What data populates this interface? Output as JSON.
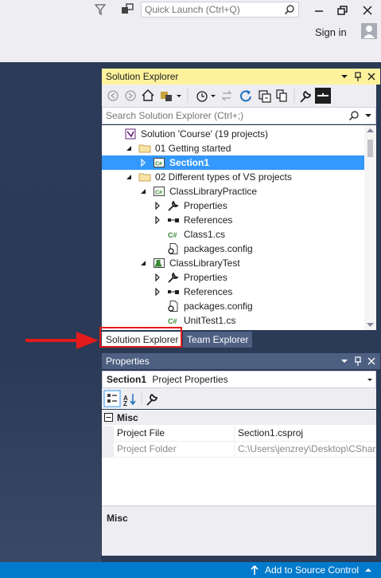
{
  "topbar": {
    "quick_launch_placeholder": "Quick Launch (Ctrl+Q)",
    "sign_in": "Sign in",
    "icons": [
      "filter-icon",
      "feedback-icon",
      "search-icon",
      "minimize-icon",
      "restore-icon",
      "close-icon",
      "account-icon"
    ]
  },
  "solution_explorer": {
    "title": "Solution Explorer",
    "search_placeholder": "Search Solution Explorer (Ctrl+;)",
    "toolbar_icons": [
      "back-icon",
      "forward-icon",
      "home-icon",
      "switch-views-icon",
      "pending-changes-icon",
      "sync-icon",
      "refresh-icon",
      "collapse-all-icon",
      "show-all-files-icon",
      "properties-icon",
      "preview-icon"
    ],
    "tree": [
      {
        "label": "Solution 'Course' (19 projects)",
        "icon": "solution-icon",
        "expander": "none",
        "selected": false
      },
      {
        "label": "01 Getting started",
        "icon": "folder-icon",
        "expander": "expanded",
        "selected": false
      },
      {
        "label": "Section1",
        "icon": "csharp-project-icon",
        "expander": "collapsed",
        "selected": true
      },
      {
        "label": "02 Different types of VS projects",
        "icon": "folder-icon",
        "expander": "expanded",
        "selected": false
      },
      {
        "label": "ClassLibraryPractice",
        "icon": "csharp-project-icon",
        "expander": "expanded",
        "selected": false
      },
      {
        "label": "Properties",
        "icon": "wrench-icon",
        "expander": "collapsed",
        "selected": false
      },
      {
        "label": "References",
        "icon": "references-icon",
        "expander": "collapsed",
        "selected": false
      },
      {
        "label": "Class1.cs",
        "icon": "csharp-file-icon",
        "expander": "none",
        "selected": false
      },
      {
        "label": "packages.config",
        "icon": "config-file-icon",
        "expander": "none",
        "selected": false
      },
      {
        "label": "ClassLibraryTest",
        "icon": "test-project-icon",
        "expander": "expanded",
        "selected": false
      },
      {
        "label": "Properties",
        "icon": "wrench-icon",
        "expander": "collapsed",
        "selected": false
      },
      {
        "label": "References",
        "icon": "references-icon",
        "expander": "collapsed",
        "selected": false
      },
      {
        "label": "packages.config",
        "icon": "config-file-icon",
        "expander": "none",
        "selected": false
      },
      {
        "label": "UnitTest1.cs",
        "icon": "csharp-file-icon",
        "expander": "none",
        "selected": false
      }
    ]
  },
  "tabs": [
    {
      "label": "Solution Explorer",
      "active": true
    },
    {
      "label": "Team Explorer",
      "active": false
    }
  ],
  "properties": {
    "title": "Properties",
    "object_name": "Section1",
    "object_type": "Project Properties",
    "category": "Misc",
    "rows": [
      {
        "name": "Project File",
        "value": "Section1.csproj",
        "readonly": false
      },
      {
        "name": "Project Folder",
        "value": "C:\\Users\\jenzrey\\Desktop\\CSharp",
        "readonly": true
      }
    ],
    "description_title": "Misc"
  },
  "status_bar": {
    "source_control": "Add to Source Control"
  },
  "colors": {
    "active_title": "#fff29d",
    "inactive_title": "#4d6082",
    "selection": "#3399ff",
    "status_bar": "#007acc",
    "highlight_box": "#e31b1b"
  }
}
